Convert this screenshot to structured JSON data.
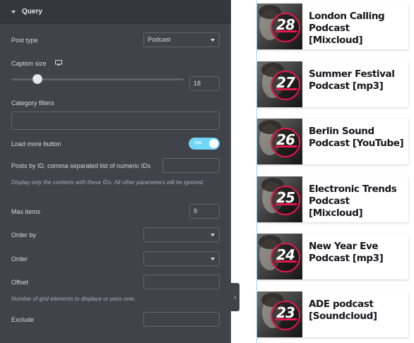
{
  "panel": {
    "section_title": "Query",
    "post_type": {
      "label": "Post type",
      "value": "Podcast"
    },
    "caption_size": {
      "label": "Caption size",
      "value": "18",
      "slider_fraction": 0.12,
      "device_icon": "monitor-icon"
    },
    "category_filters": {
      "label": "Category filters",
      "value": ""
    },
    "load_more": {
      "label": "Load more button",
      "toggle_text": "YES",
      "enabled": true
    },
    "posts_by_id": {
      "label": "Posts by ID, comma separated list of numeric IDs",
      "value": "",
      "description": "Display only the contents with these IDs. All other parameters will be ignored."
    },
    "max_items": {
      "label": "Max items",
      "value": "9"
    },
    "order_by": {
      "label": "Order by",
      "value": ""
    },
    "order": {
      "label": "Order",
      "value": ""
    },
    "offset": {
      "label": "Offset",
      "value": "",
      "description": "Number of grid elements to displace or pass over."
    },
    "exclude": {
      "label": "Exclude",
      "value": ""
    },
    "collapse_icon": "chevron-left-icon"
  },
  "preview": {
    "accent_color": "#e8184a",
    "cards": [
      {
        "number": "28",
        "title": "London Calling Podcast [Mixcloud]"
      },
      {
        "number": "27",
        "title": "Summer Festival Podcast [mp3]"
      },
      {
        "number": "26",
        "title": "Berlin Sound Podcast [YouTube]"
      },
      {
        "number": "25",
        "title": "Electronic Trends Podcast [Mixcloud]"
      },
      {
        "number": "24",
        "title": "New Year Eve Podcast [mp3]"
      },
      {
        "number": "23",
        "title": "ADE podcast [Soundcloud]"
      }
    ]
  }
}
